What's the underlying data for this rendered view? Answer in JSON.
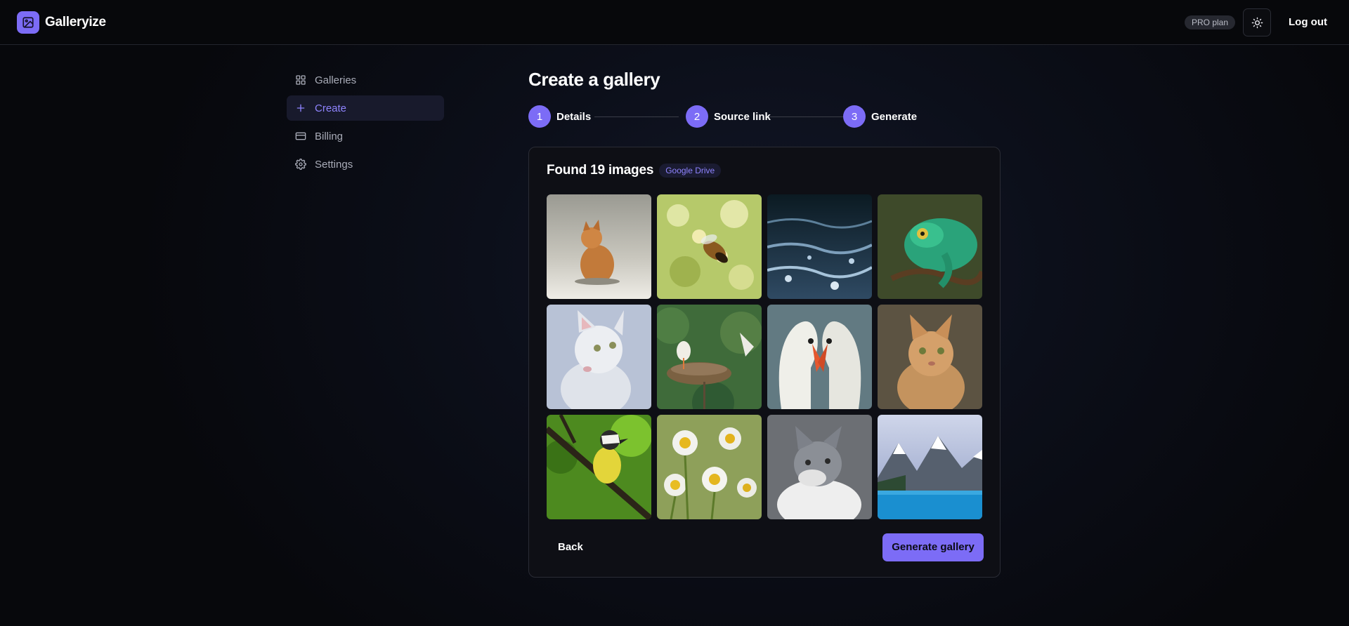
{
  "app": {
    "name": "Galleryize",
    "logo_icon": "image-icon"
  },
  "header": {
    "plan_badge": "PRO plan",
    "theme_toggle_icon": "sun-icon",
    "logout_label": "Log out"
  },
  "sidebar": {
    "items": [
      {
        "label": "Galleries",
        "icon": "grid-icon",
        "active": false
      },
      {
        "label": "Create",
        "icon": "plus-icon",
        "active": true
      },
      {
        "label": "Billing",
        "icon": "credit-card-icon",
        "active": false
      },
      {
        "label": "Settings",
        "icon": "gear-icon",
        "active": false
      }
    ]
  },
  "main": {
    "title": "Create a gallery",
    "steps": [
      {
        "number": "1",
        "label": "Details"
      },
      {
        "number": "2",
        "label": "Source link"
      },
      {
        "number": "3",
        "label": "Generate"
      }
    ],
    "card": {
      "title": "Found 19 images",
      "source_badge": "Google Drive",
      "thumbnails": [
        {
          "subject": "orange-kitten"
        },
        {
          "subject": "bee-on-flowers"
        },
        {
          "subject": "water-ripples"
        },
        {
          "subject": "chameleon"
        },
        {
          "subject": "white-kitten"
        },
        {
          "subject": "storks-nest"
        },
        {
          "subject": "swans"
        },
        {
          "subject": "ginger-cat"
        },
        {
          "subject": "yellow-bird"
        },
        {
          "subject": "chamomile-flowers"
        },
        {
          "subject": "grey-fluffy-cat"
        },
        {
          "subject": "mountain-lake"
        }
      ],
      "back_label": "Back",
      "generate_label": "Generate gallery"
    }
  },
  "colors": {
    "accent": "#7c6cf6",
    "accent_text": "#8f84ff",
    "background": "#07080c",
    "card_bg": "#0e0f15",
    "border": "#2a2c35"
  }
}
